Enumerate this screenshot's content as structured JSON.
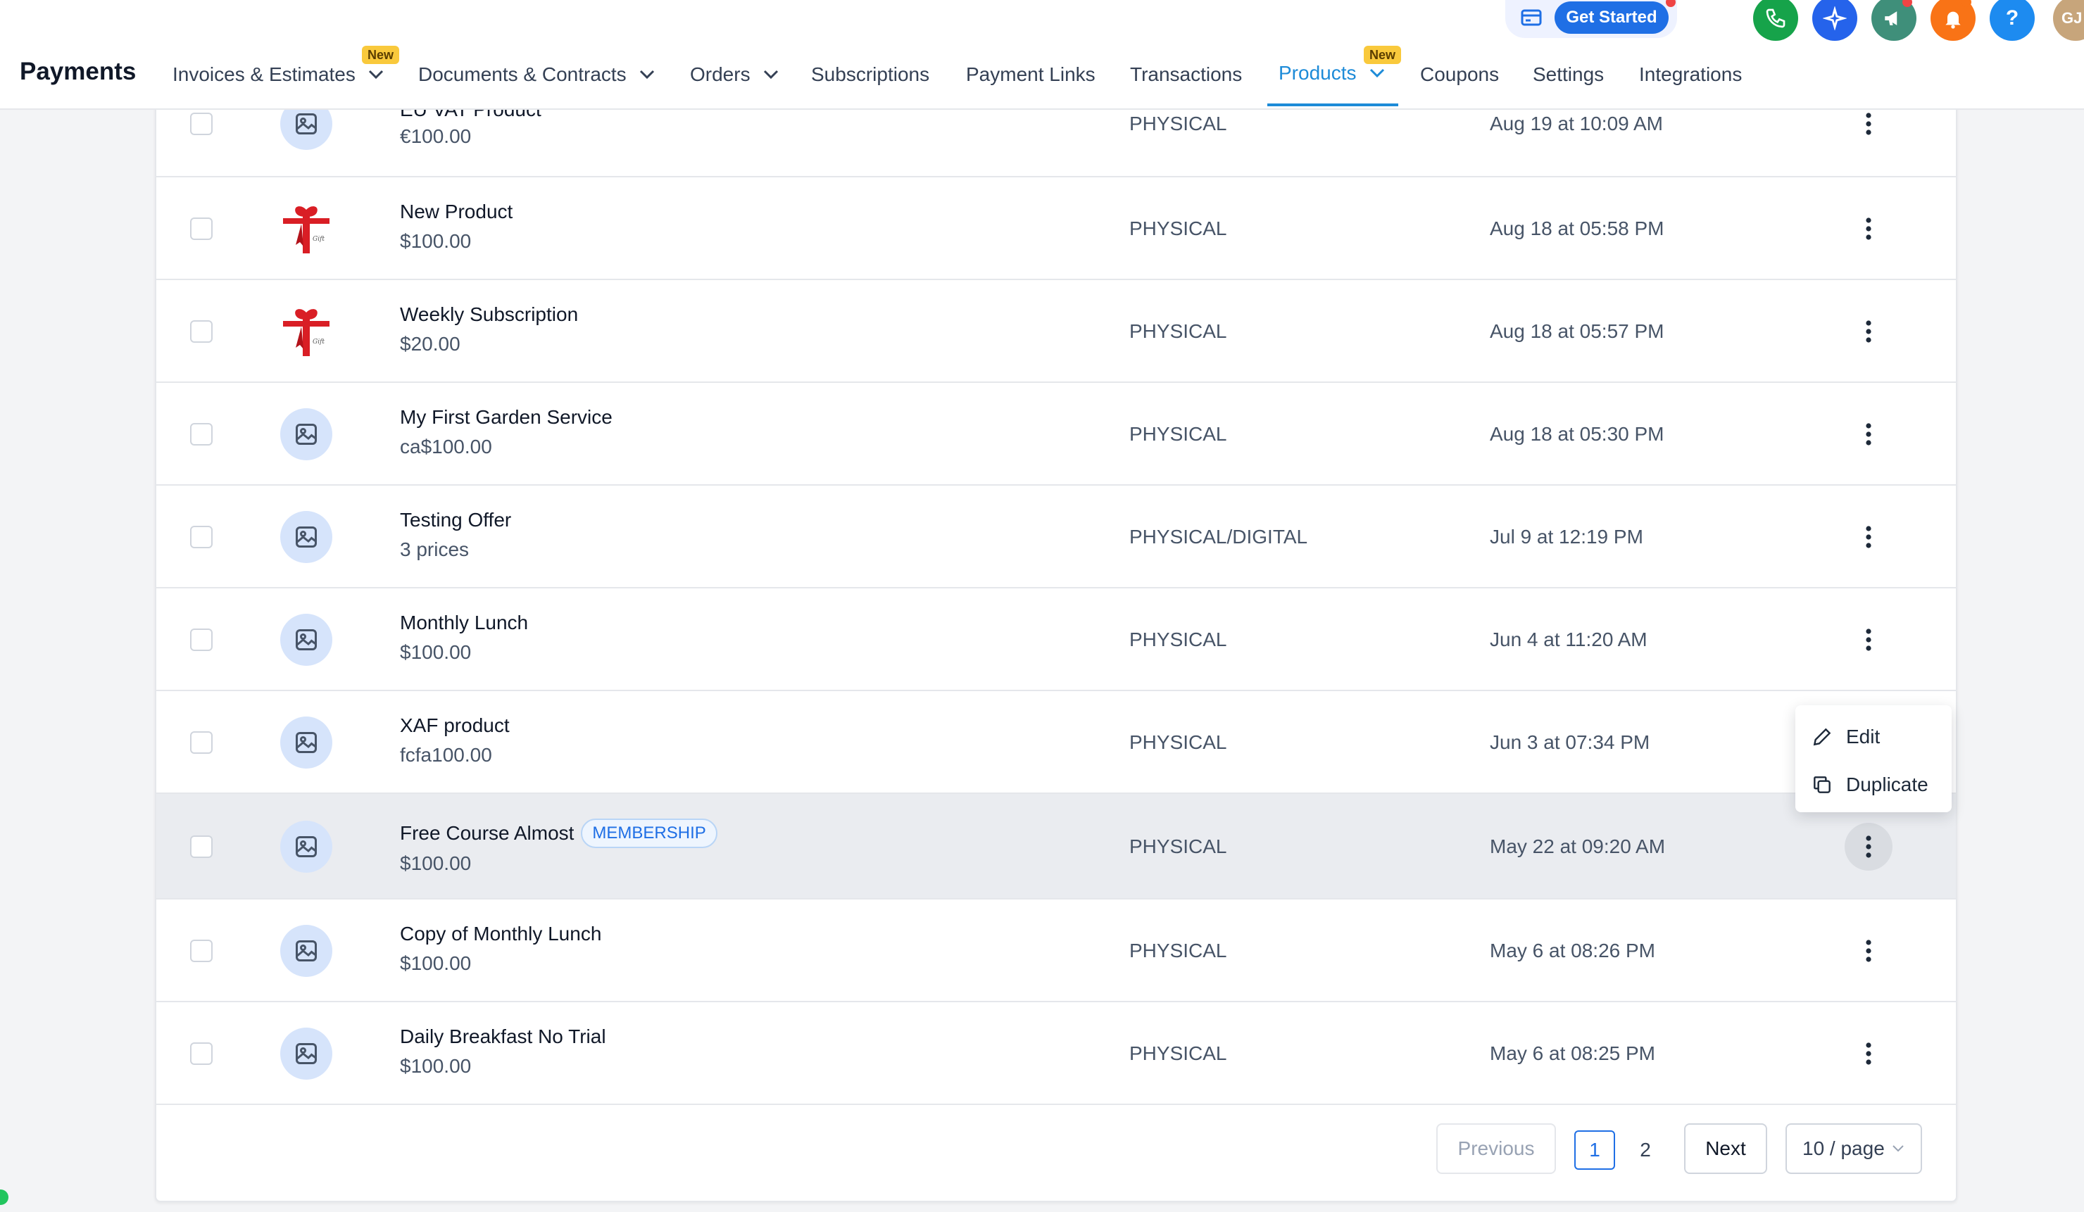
{
  "header": {
    "title": "Payments",
    "get_started": "Get Started",
    "avatar_initials": "GJ",
    "help_glyph": "?",
    "nav": [
      {
        "label": "Invoices & Estimates",
        "badge": "New",
        "dropdown": true
      },
      {
        "label": "Documents & Contracts",
        "dropdown": true
      },
      {
        "label": "Orders",
        "dropdown": true
      },
      {
        "label": "Subscriptions"
      },
      {
        "label": "Payment Links"
      },
      {
        "label": "Transactions"
      },
      {
        "label": "Products",
        "badge": "New",
        "dropdown": true,
        "active": true
      },
      {
        "label": "Coupons"
      },
      {
        "label": "Settings"
      },
      {
        "label": "Integrations"
      }
    ],
    "icons": [
      "card-icon",
      "phone-icon",
      "sparkle-icon",
      "megaphone-icon",
      "bell-icon",
      "help-icon"
    ],
    "colors": {
      "active_tab": "#1d8bd8",
      "primary": "#1f6fe5",
      "phone": "#16a34a",
      "sparkle": "#2563eb",
      "megaphone": "#3f8f7a",
      "bell": "#f97316",
      "help": "#1d8bf0"
    }
  },
  "products": [
    {
      "name": "EU VAT Product",
      "price": "€100.00",
      "type": "PHYSICAL",
      "date": "Aug 19 at 10:09 AM",
      "image": "placeholder-image-icon"
    },
    {
      "name": "New Product",
      "price": "$100.00",
      "type": "PHYSICAL",
      "date": "Aug 18 at 05:58 PM",
      "image": "gift-bow-image"
    },
    {
      "name": "Weekly Subscription",
      "price": "$20.00",
      "type": "PHYSICAL",
      "date": "Aug 18 at 05:57 PM",
      "image": "gift-bow-image"
    },
    {
      "name": "My First Garden Service",
      "price": "ca$100.00",
      "type": "PHYSICAL",
      "date": "Aug 18 at 05:30 PM",
      "image": "placeholder-image-icon"
    },
    {
      "name": "Testing Offer",
      "price": "3 prices",
      "type": "PHYSICAL/DIGITAL",
      "date": "Jul 9 at 12:19 PM",
      "image": "placeholder-image-icon"
    },
    {
      "name": "Monthly Lunch",
      "price": "$100.00",
      "type": "PHYSICAL",
      "date": "Jun 4 at 11:20 AM",
      "image": "placeholder-image-icon"
    },
    {
      "name": "XAF product",
      "price": "fcfa100.00",
      "type": "PHYSICAL",
      "date": "Jun 3 at 07:34 PM",
      "image": "placeholder-image-icon"
    },
    {
      "name": "Free Course Almost",
      "badge": "MEMBERSHIP",
      "price": "$100.00",
      "type": "PHYSICAL",
      "date": "May 22 at 09:20 AM",
      "image": "placeholder-image-icon",
      "hovered": true
    },
    {
      "name": "Copy of Monthly Lunch",
      "price": "$100.00",
      "type": "PHYSICAL",
      "date": "May 6 at 08:26 PM",
      "image": "placeholder-image-icon"
    },
    {
      "name": "Daily Breakfast No Trial",
      "price": "$100.00",
      "type": "PHYSICAL",
      "date": "May 6 at 08:25 PM",
      "image": "placeholder-image-icon"
    }
  ],
  "context_menu": {
    "items": [
      {
        "label": "Edit",
        "icon": "pencil-icon"
      },
      {
        "label": "Duplicate",
        "icon": "copy-icon"
      }
    ]
  },
  "pagination": {
    "previous": "Previous",
    "next": "Next",
    "pages": [
      "1",
      "2"
    ],
    "current_page": "1",
    "page_size": "10 / page"
  }
}
